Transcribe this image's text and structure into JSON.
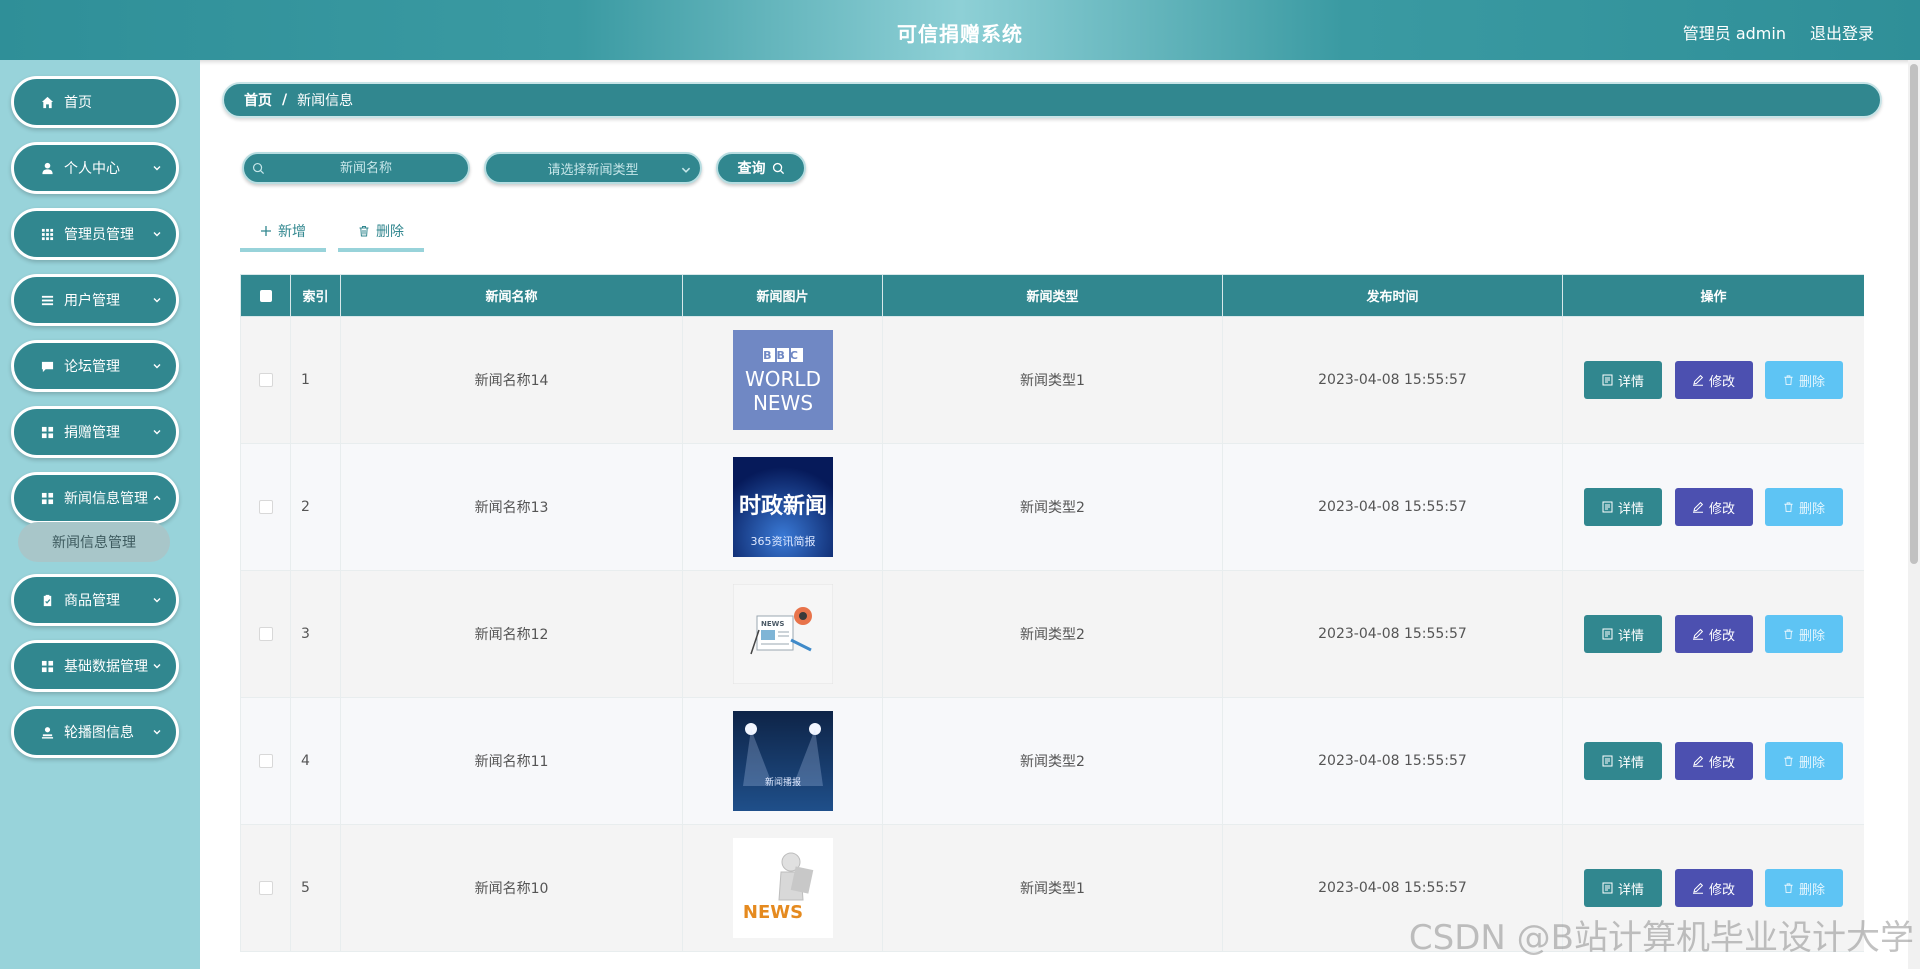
{
  "header": {
    "title": "可信捐赠系统",
    "user_label": "管理员 admin",
    "logout_label": "退出登录"
  },
  "sidebar": {
    "items": [
      {
        "label": "首页",
        "icon": "home-icon",
        "has_arrow": false
      },
      {
        "label": "个人中心",
        "icon": "user-icon",
        "has_arrow": true
      },
      {
        "label": "管理员管理",
        "icon": "grid-icon",
        "has_arrow": true
      },
      {
        "label": "用户管理",
        "icon": "list-icon",
        "has_arrow": true
      },
      {
        "label": "论坛管理",
        "icon": "chat-icon",
        "has_arrow": true
      },
      {
        "label": "捐赠管理",
        "icon": "apps-icon",
        "has_arrow": true
      },
      {
        "label": "新闻信息管理",
        "icon": "apps-icon",
        "has_arrow": true
      },
      {
        "label": "商品管理",
        "icon": "clipboard-icon",
        "has_arrow": true
      },
      {
        "label": "基础数据管理",
        "icon": "apps-icon",
        "has_arrow": true
      },
      {
        "label": "轮播图信息",
        "icon": "person-icon",
        "has_arrow": true
      }
    ],
    "submenu": {
      "label": "新闻信息管理"
    }
  },
  "breadcrumb": {
    "home": "首页",
    "separator": "/",
    "current": "新闻信息"
  },
  "search": {
    "name_placeholder": "新闻名称",
    "type_placeholder": "请选择新闻类型",
    "query_label": "查询"
  },
  "actions": {
    "add_label": "新增",
    "delete_label": "删除"
  },
  "table": {
    "headers": {
      "index": "索引",
      "name": "新闻名称",
      "image": "新闻图片",
      "type": "新闻类型",
      "time": "发布时间",
      "ops": "操作"
    },
    "rows": [
      {
        "index": "1",
        "name": "新闻名称14",
        "type": "新闻类型1",
        "time": "2023-04-08 15:55:57",
        "image": "bbc-world-news"
      },
      {
        "index": "2",
        "name": "新闻名称13",
        "type": "新闻类型2",
        "time": "2023-04-08 15:55:57",
        "image": "political-news"
      },
      {
        "index": "3",
        "name": "新闻名称12",
        "type": "新闻类型2",
        "time": "2023-04-08 15:55:57",
        "image": "news-illustration"
      },
      {
        "index": "4",
        "name": "新闻名称11",
        "type": "新闻类型2",
        "time": "2023-04-08 15:55:57",
        "image": "spotlight-stage"
      },
      {
        "index": "5",
        "name": "新闻名称10",
        "type": "新闻类型1",
        "time": "2023-04-08 15:55:57",
        "image": "news-3d-figure"
      }
    ],
    "op_labels": {
      "detail": "详情",
      "edit": "修改",
      "delete": "删除"
    },
    "thumb_text": {
      "bbc_line1": "BBC",
      "bbc_line2": "WORLD",
      "bbc_line3": "NEWS",
      "political_main": "时政新闻",
      "political_sub": "365资讯简报",
      "illustration_label": "NEWS",
      "stage_label": "新闻播报",
      "figure_label": "NEWS"
    }
  },
  "colors": {
    "primary": "#31878f",
    "sidebar_bg": "#98d3da",
    "edit": "#4c50b0",
    "delete": "#5ec4f4"
  },
  "watermark": "CSDN @B站计算机毕业设计大学"
}
